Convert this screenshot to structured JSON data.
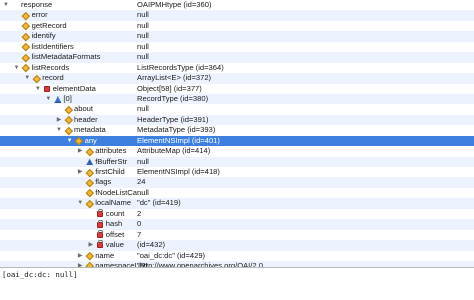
{
  "tree": [
    {
      "name": "response",
      "value": "OAIPMHtype  (id=360)",
      "depth": 0,
      "toggle": "open",
      "icon": "none"
    },
    {
      "name": "error",
      "value": "null",
      "depth": 1,
      "toggle": "none",
      "icon": "diamond"
    },
    {
      "name": "getRecord",
      "value": "null",
      "depth": 1,
      "toggle": "none",
      "icon": "diamond"
    },
    {
      "name": "identify",
      "value": "null",
      "depth": 1,
      "toggle": "none",
      "icon": "diamond"
    },
    {
      "name": "listIdentifiers",
      "value": "null",
      "depth": 1,
      "toggle": "none",
      "icon": "diamond"
    },
    {
      "name": "listMetadataFormats",
      "value": "null",
      "depth": 1,
      "toggle": "none",
      "icon": "diamond"
    },
    {
      "name": "listRecords",
      "value": "ListRecordsType  (id=364)",
      "depth": 1,
      "toggle": "open",
      "icon": "diamond"
    },
    {
      "name": "record",
      "value": "ArrayList<E>  (id=372)",
      "depth": 2,
      "toggle": "open",
      "icon": "diamond"
    },
    {
      "name": "elementData",
      "value": "Object[58]  (id=377)",
      "depth": 3,
      "toggle": "open",
      "icon": "field"
    },
    {
      "name": "[0]",
      "value": "RecordType  (id=380)",
      "depth": 4,
      "toggle": "open",
      "icon": "array"
    },
    {
      "name": "about",
      "value": "null",
      "depth": 5,
      "toggle": "none",
      "icon": "diamond"
    },
    {
      "name": "header",
      "value": "HeaderType  (id=391)",
      "depth": 5,
      "toggle": "closed",
      "icon": "diamond"
    },
    {
      "name": "metadata",
      "value": "MetadataType  (id=393)",
      "depth": 5,
      "toggle": "open",
      "icon": "diamond"
    },
    {
      "name": "any",
      "value": "ElementNSImpl  (id=401)",
      "depth": 6,
      "toggle": "open",
      "icon": "diamond",
      "selected": true
    },
    {
      "name": "attributes",
      "value": "AttributeMap  (id=414)",
      "depth": 7,
      "toggle": "closed",
      "icon": "diamond"
    },
    {
      "name": "fBufferStr",
      "value": "null",
      "depth": 7,
      "toggle": "none",
      "icon": "tri-blue"
    },
    {
      "name": "firstChild",
      "value": "ElementNSImpl  (id=418)",
      "depth": 7,
      "toggle": "closed",
      "icon": "diamond"
    },
    {
      "name": "flags",
      "value": "24",
      "depth": 7,
      "toggle": "none",
      "icon": "diamond"
    },
    {
      "name": "fNodeListCa...",
      "value": "null",
      "depth": 7,
      "toggle": "none",
      "icon": "diamond"
    },
    {
      "name": "localName",
      "value": "\"dc\"  (id=419)",
      "depth": 7,
      "toggle": "open",
      "icon": "diamond"
    },
    {
      "name": "count",
      "value": "2",
      "depth": 8,
      "toggle": "none",
      "icon": "field"
    },
    {
      "name": "hash",
      "value": "0",
      "depth": 8,
      "toggle": "none",
      "icon": "field"
    },
    {
      "name": "offset",
      "value": "7",
      "depth": 8,
      "toggle": "none",
      "icon": "field"
    },
    {
      "name": "value",
      "value": "(id=432)",
      "depth": 8,
      "toggle": "closed",
      "icon": "field"
    },
    {
      "name": "name",
      "value": "\"oai_dc:dc\"  (id=429)",
      "depth": 7,
      "toggle": "closed",
      "icon": "diamond"
    },
    {
      "name": "namespaceURI",
      "value": "\"http://www.openarchives.org/OAI/2.0...",
      "depth": 7,
      "toggle": "closed",
      "icon": "diamond"
    }
  ],
  "detail": {
    "text": "[oai_dc:dc: null]"
  }
}
